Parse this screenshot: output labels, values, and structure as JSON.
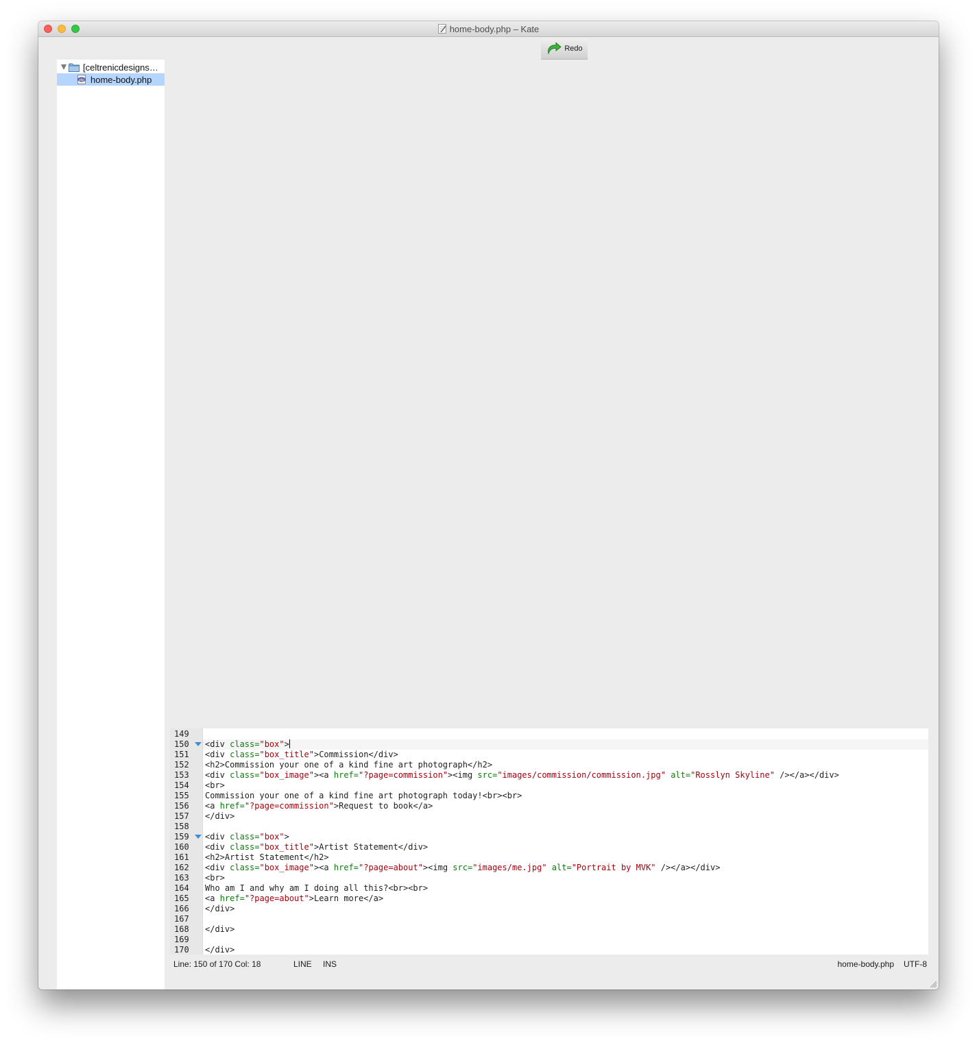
{
  "window": {
    "title": "home-body.php – Kate"
  },
  "toolbar": {
    "redo_label": "Redo",
    "redo_icon": "redo-icon"
  },
  "sidebar": {
    "folder_label": "[celtrenicdesigns…",
    "file_label": "home-body.php"
  },
  "editor": {
    "lines": [
      {
        "num": "149",
        "fold": false,
        "current": false,
        "tokens": []
      },
      {
        "num": "150",
        "fold": true,
        "current": true,
        "cursor": true,
        "tokens": [
          [
            "tg",
            "<div "
          ],
          [
            "at",
            "class="
          ],
          [
            "st",
            "\"box\""
          ],
          [
            "tg",
            ">"
          ]
        ]
      },
      {
        "num": "151",
        "fold": false,
        "current": false,
        "tokens": [
          [
            "tg",
            "<div "
          ],
          [
            "at",
            "class="
          ],
          [
            "st",
            "\"box_title\""
          ],
          [
            "tg",
            ">"
          ],
          [
            "tx",
            "Commission"
          ],
          [
            "tg",
            "</div>"
          ]
        ]
      },
      {
        "num": "152",
        "fold": false,
        "current": false,
        "tokens": [
          [
            "tg",
            "<h2>"
          ],
          [
            "tx",
            "Commission your one of a kind fine art photograph"
          ],
          [
            "tg",
            "</h2>"
          ]
        ]
      },
      {
        "num": "153",
        "fold": false,
        "current": false,
        "tokens": [
          [
            "tg",
            "<div "
          ],
          [
            "at",
            "class="
          ],
          [
            "st",
            "\"box_image\""
          ],
          [
            "tg",
            "><a "
          ],
          [
            "at",
            "href="
          ],
          [
            "st",
            "\"?page=commission\""
          ],
          [
            "tg",
            "><img "
          ],
          [
            "at",
            "src="
          ],
          [
            "st",
            "\"images/commission/commission.jpg\""
          ],
          [
            "tg",
            " "
          ],
          [
            "at",
            "alt="
          ],
          [
            "st",
            "\"Rosslyn Skyline\""
          ],
          [
            "tg",
            " /></a></div>"
          ]
        ]
      },
      {
        "num": "154",
        "fold": false,
        "current": false,
        "tokens": [
          [
            "tg",
            "<br>"
          ]
        ]
      },
      {
        "num": "155",
        "fold": false,
        "current": false,
        "tokens": [
          [
            "tx",
            "Commission your one of a kind fine art photograph today!"
          ],
          [
            "tg",
            "<br><br>"
          ]
        ]
      },
      {
        "num": "156",
        "fold": false,
        "current": false,
        "tokens": [
          [
            "tg",
            "<a "
          ],
          [
            "at",
            "href="
          ],
          [
            "st",
            "\"?page=commission\""
          ],
          [
            "tg",
            ">"
          ],
          [
            "tx",
            "Request to book"
          ],
          [
            "tg",
            "</a>"
          ]
        ]
      },
      {
        "num": "157",
        "fold": false,
        "current": false,
        "tokens": [
          [
            "tg",
            "</div>"
          ]
        ]
      },
      {
        "num": "158",
        "fold": false,
        "current": false,
        "tokens": []
      },
      {
        "num": "159",
        "fold": true,
        "current": false,
        "tokens": [
          [
            "tg",
            "<div "
          ],
          [
            "at",
            "class="
          ],
          [
            "st",
            "\"box\""
          ],
          [
            "tg",
            ">"
          ]
        ]
      },
      {
        "num": "160",
        "fold": false,
        "current": false,
        "tokens": [
          [
            "tg",
            "<div "
          ],
          [
            "at",
            "class="
          ],
          [
            "st",
            "\"box_title\""
          ],
          [
            "tg",
            ">"
          ],
          [
            "tx",
            "Artist Statement"
          ],
          [
            "tg",
            "</div>"
          ]
        ]
      },
      {
        "num": "161",
        "fold": false,
        "current": false,
        "tokens": [
          [
            "tg",
            "<h2>"
          ],
          [
            "tx",
            "Artist Statement"
          ],
          [
            "tg",
            "</h2>"
          ]
        ]
      },
      {
        "num": "162",
        "fold": false,
        "current": false,
        "tokens": [
          [
            "tg",
            "<div "
          ],
          [
            "at",
            "class="
          ],
          [
            "st",
            "\"box_image\""
          ],
          [
            "tg",
            "><a "
          ],
          [
            "at",
            "href="
          ],
          [
            "st",
            "\"?page=about\""
          ],
          [
            "tg",
            "><img "
          ],
          [
            "at",
            "src="
          ],
          [
            "st",
            "\"images/me.jpg\""
          ],
          [
            "tg",
            " "
          ],
          [
            "at",
            "alt="
          ],
          [
            "st",
            "\"Portrait by MVK\""
          ],
          [
            "tg",
            " /></a></div>"
          ]
        ]
      },
      {
        "num": "163",
        "fold": false,
        "current": false,
        "tokens": [
          [
            "tg",
            "<br>"
          ]
        ]
      },
      {
        "num": "164",
        "fold": false,
        "current": false,
        "tokens": [
          [
            "tx",
            "Who am I and why am I doing all this?"
          ],
          [
            "tg",
            "<br><br>"
          ]
        ]
      },
      {
        "num": "165",
        "fold": false,
        "current": false,
        "tokens": [
          [
            "tg",
            "<a "
          ],
          [
            "at",
            "href="
          ],
          [
            "st",
            "\"?page=about\""
          ],
          [
            "tg",
            ">"
          ],
          [
            "tx",
            "Learn more"
          ],
          [
            "tg",
            "</a>"
          ]
        ]
      },
      {
        "num": "166",
        "fold": false,
        "current": false,
        "tokens": [
          [
            "tg",
            "</div>"
          ]
        ]
      },
      {
        "num": "167",
        "fold": false,
        "current": false,
        "tokens": []
      },
      {
        "num": "168",
        "fold": false,
        "current": false,
        "tokens": [
          [
            "tg",
            "</div>"
          ]
        ]
      },
      {
        "num": "169",
        "fold": false,
        "current": false,
        "tokens": []
      },
      {
        "num": "170",
        "fold": false,
        "current": false,
        "tokens": [
          [
            "tg",
            "</div>"
          ]
        ]
      }
    ]
  },
  "status": {
    "position": "Line: 150 of 170 Col: 18",
    "mode": "LINE",
    "insert": "INS",
    "filename": "home-body.php",
    "encoding": "UTF-8"
  },
  "colors": {
    "selection": "#b5d5ff",
    "attribute": "#0e7a0e",
    "string": "#a8000c",
    "fold_marker": "#3a8fd8"
  }
}
